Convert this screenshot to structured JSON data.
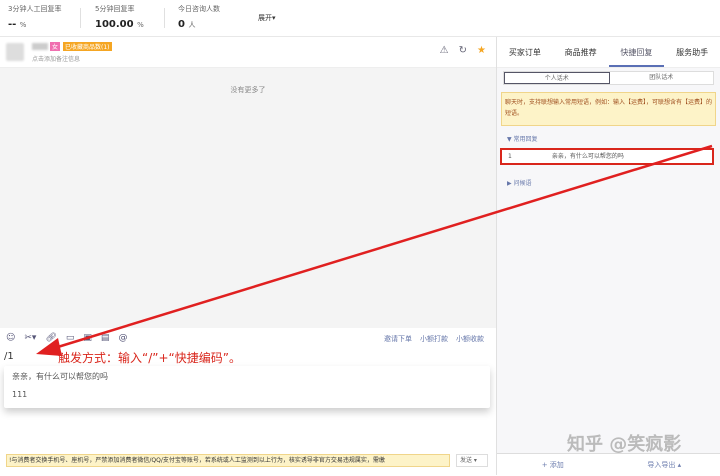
{
  "stats": [
    {
      "label": "3分钟人工回复率",
      "value": "--",
      "unit": "%"
    },
    {
      "label": "5分钟回复率",
      "value": "100.00",
      "unit": "%"
    },
    {
      "label": "今日咨询人数",
      "value": "0",
      "unit": "人"
    }
  ],
  "expand": "展开▾",
  "chat": {
    "tag_pink": "女",
    "tag_orange": "已收藏商品数(1)",
    "note": "点击添加备注信息",
    "no_more": "没有更多了",
    "links": [
      "邀请下单",
      "小额打款",
      "小额收款"
    ],
    "input_value": "/1",
    "annotation": "触发方式：输入“/”+“快捷编码”。",
    "suggestions": [
      "亲亲，有什么可以帮您的吗",
      "111"
    ],
    "warning": "!与消费者交换手机号、座机号，严禁添加消费者微信/QQ/支付宝等账号，若系统或人工监测到以上行为，核实诱导非官方交易违规属实，需缴",
    "send": "发送"
  },
  "right": {
    "tabs": [
      "买家订单",
      "商品推荐",
      "快捷回复",
      "服务助手"
    ],
    "active_tab": 2,
    "segments": [
      "个人话术",
      "团队话术"
    ],
    "tip": "聊天时，支持联想输入常用短语，例如：输入【运费】，可联想含有【运费】的短语。",
    "group1": "▼ 常用回复",
    "item_code": "1",
    "item_text": "亲亲，有什么可以帮您的吗",
    "group2": "▶ 问候语",
    "add": "+ 添加",
    "import_export": "导入导出 ▴"
  },
  "watermark": "知乎 @笑疯影",
  "colors": {
    "accent": "#5a6fb5",
    "annotation": "#d9261c"
  }
}
